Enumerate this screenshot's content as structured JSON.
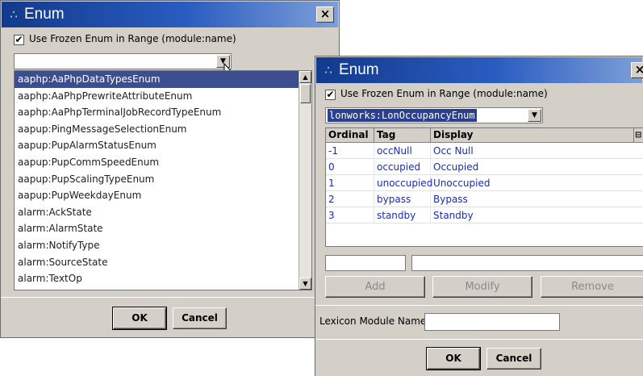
{
  "dialog_back": {
    "title": "Enum",
    "close_label": "×",
    "frozen_label": "Use Frozen Enum in Range (module:name)",
    "check_mark": "✔",
    "combo_value": "",
    "list_items": [
      "aaphp:AaPhpDataTypesEnum",
      "aaphp:AaPhpPrewriteAttributeEnum",
      "aaphp:AaPhpTerminalJobRecordTypeEnum",
      "aapup:PingMessageSelectionEnum",
      "aapup:PupAlarmStatusEnum",
      "aapup:PupCommSpeedEnum",
      "aapup:PupScalingTypeEnum",
      "aapup:PupWeekdayEnum",
      "alarm:AckState",
      "alarm:AlarmState",
      "alarm:NotifyType",
      "alarm:SourceState",
      "alarm:TextOp"
    ],
    "selected_index": 0,
    "ok_label": "OK",
    "cancel_label": "Cancel"
  },
  "dialog_front": {
    "title": "Enum",
    "close_label": "×",
    "frozen_label": "Use Frozen Enum in Range (module:name)",
    "check_mark": "✔",
    "combo_value": "lonworks:LonOccupancyEnum",
    "columns": [
      "Ordinal",
      "Tag",
      "Display"
    ],
    "rows": [
      {
        "ordinal": "-1",
        "tag": "occNull",
        "display": "Occ Null"
      },
      {
        "ordinal": "0",
        "tag": "occupied",
        "display": "Occupied"
      },
      {
        "ordinal": "1",
        "tag": "unoccupied",
        "display": "Unoccupied"
      },
      {
        "ordinal": "2",
        "tag": "bypass",
        "display": "Bypass"
      },
      {
        "ordinal": "3",
        "tag": "standby",
        "display": "Standby"
      }
    ],
    "add_label": "Add",
    "modify_label": "Modify",
    "remove_label": "Remove",
    "lexicon_label": "Lexicon Module Name",
    "lexicon_value": "",
    "ok_label": "OK",
    "cancel_label": "Cancel"
  },
  "icons": {
    "app_icon": "∴",
    "combo_arrow": "▼",
    "scroll_up": "▲",
    "scroll_down": "▼",
    "column_chooser": "⊟",
    "cursor": "mouse-cursor-icon"
  }
}
